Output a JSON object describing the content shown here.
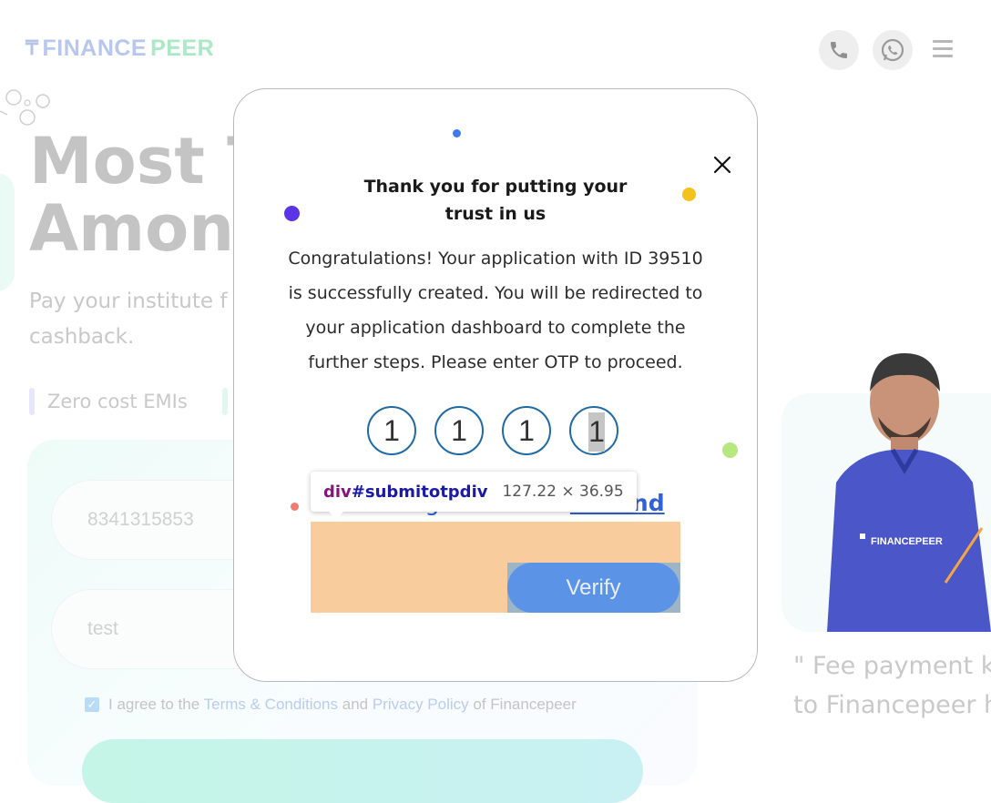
{
  "header": {
    "logo_left": "FINANCE",
    "logo_right": "PEER",
    "phone_icon": "phone-icon",
    "whatsapp_icon": "whatsapp-icon",
    "menu_icon": "hamburger-menu-icon"
  },
  "hero": {
    "title": "Most T\nAmong",
    "subtitle": "Pay your institute f cashback.",
    "feature_1": "Zero cost EMIs"
  },
  "form": {
    "phone_value": "8341315853",
    "name_value": "test",
    "agree_prefix": "I agree to the",
    "terms_link": "Terms & Conditions",
    "and_text": "and",
    "privacy_link": "Privacy Policy",
    "agree_suffix": "of Financepeer"
  },
  "promo": {
    "shirt_text": "FINANCEPEER",
    "quote": "\" Fee payment k\nto Financepeer h"
  },
  "modal": {
    "title": "Thank you for putting your trust in us",
    "message": "Congratulations! Your application with ID 39510 is successfully created. You will be redirected to your application dashboard to complete the further steps. Please enter OTP to proceed.",
    "otp": [
      "1",
      "1",
      "1",
      "1"
    ],
    "resend_prefix": "Didn't get an OTP?",
    "resend_link": "Resend",
    "verify_label": "Verify",
    "close_icon": "close-icon"
  },
  "devtools_tooltip": {
    "tag": "div",
    "selector": "#submitotpdiv",
    "size": "127.22 × 36.95"
  },
  "colors": {
    "otp_border": "#1f6aa5",
    "verify": "#5b93e6",
    "link": "#2f61d8",
    "highlight_padding": "#f6b26b",
    "highlight_content": "#6fa8dc"
  }
}
